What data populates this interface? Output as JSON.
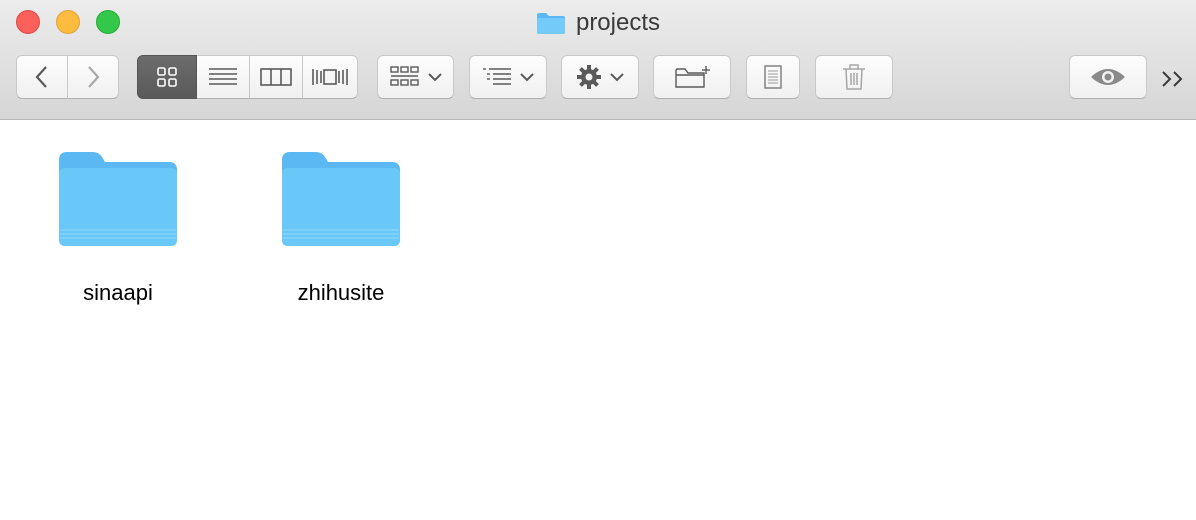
{
  "window": {
    "title": "projects",
    "title_icon": "folder-icon"
  },
  "toolbar": {
    "back_icon": "chevron-left-icon",
    "forward_icon": "chevron-right-icon",
    "view_modes": [
      "icon-view-icon",
      "list-view-icon",
      "column-view-icon",
      "cover-flow-icon"
    ],
    "active_view": "icon-view-icon",
    "arrange_icon": "grid-arrange-icon",
    "sort_icon": "sort-list-icon",
    "action_icon": "gear-icon",
    "new_folder_icon": "new-folder-icon",
    "get_info_icon": "document-icon",
    "trash_icon": "trash-icon",
    "quicklook_icon": "eye-icon",
    "overflow_icon": "double-chevron-right-icon"
  },
  "files": [
    {
      "name": "sinaapi",
      "kind": "folder"
    },
    {
      "name": "zhihusite",
      "kind": "folder"
    }
  ],
  "colors": {
    "close": "#fc605b",
    "minimize": "#fdbc40",
    "maximize": "#34c84a",
    "folder": "#6ac8f8"
  }
}
